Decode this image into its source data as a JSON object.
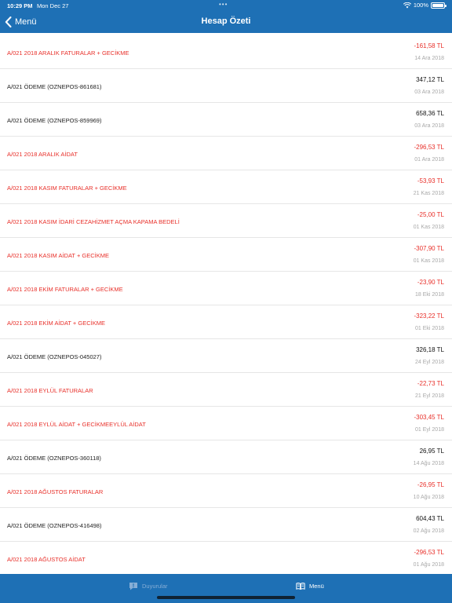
{
  "status_bar": {
    "time": "10:29 PM",
    "date": "Mon Dec 27",
    "battery": "100%"
  },
  "nav": {
    "back_label": "Menü",
    "title": "Hesap Özeti"
  },
  "colors": {
    "accent": "#1e70b5",
    "negative": "#e8302a",
    "muted": "#a8a8a8"
  },
  "transactions": [
    {
      "desc": "A/021 2018 ARALIK FATURALAR + GECİKME",
      "amount": "-161,58 TL",
      "date": "14 Ara 2018"
    },
    {
      "desc": "A/021 ÖDEME (OZNEPOS-861681)",
      "amount": "347,12 TL",
      "date": "03 Ara 2018"
    },
    {
      "desc": "A/021 ÖDEME (OZNEPOS-859969)",
      "amount": "658,36 TL",
      "date": "03 Ara 2018"
    },
    {
      "desc": "A/021 2018 ARALIK AİDAT",
      "amount": "-296,53 TL",
      "date": "01 Ara 2018"
    },
    {
      "desc": "A/021 2018 KASIM FATURALAR + GECİKME",
      "amount": "-53,93 TL",
      "date": "21 Kas 2018"
    },
    {
      "desc": "A/021 2018 KASIM İDARİ CEZAHİZMET AÇMA KAPAMA BEDELİ",
      "amount": "-25,00 TL",
      "date": "01 Kas 2018"
    },
    {
      "desc": "A/021 2018 KASIM AİDAT + GECİKME",
      "amount": "-307,90 TL",
      "date": "01 Kas 2018"
    },
    {
      "desc": "A/021 2018 EKİM FATURALAR + GECİKME",
      "amount": "-23,90 TL",
      "date": "18 Eki 2018"
    },
    {
      "desc": "A/021 2018 EKİM AİDAT + GECİKME",
      "amount": "-323,22 TL",
      "date": "01 Eki 2018"
    },
    {
      "desc": "A/021 ÖDEME (OZNEPOS-045027)",
      "amount": "326,18 TL",
      "date": "24 Eyl 2018"
    },
    {
      "desc": "A/021 2018 EYLÜL FATURALAR",
      "amount": "-22,73 TL",
      "date": "21 Eyl 2018"
    },
    {
      "desc": "A/021 2018 EYLÜL AİDAT + GECİKMEEYLÜL AİDAT",
      "amount": "-303,45 TL",
      "date": "01 Eyl 2018"
    },
    {
      "desc": "A/021 ÖDEME (OZNEPOS-360118)",
      "amount": "26,95 TL",
      "date": "14 Ağu 2018"
    },
    {
      "desc": "A/021 2018 AĞUSTOS FATURALAR",
      "amount": "-26,95 TL",
      "date": "10 Ağu 2018"
    },
    {
      "desc": "A/021 ÖDEME (OZNEPOS-416498)",
      "amount": "604,43 TL",
      "date": "02 Ağu 2018"
    },
    {
      "desc": "A/021 2018 AĞUSTOS AİDAT",
      "amount": "-296,53 TL",
      "date": "01 Ağu 2018"
    }
  ],
  "tabbar": {
    "tabs": [
      {
        "label": "Duyurular",
        "icon": "announcement-icon"
      },
      {
        "label": "Menü",
        "icon": "book-icon"
      }
    ]
  }
}
